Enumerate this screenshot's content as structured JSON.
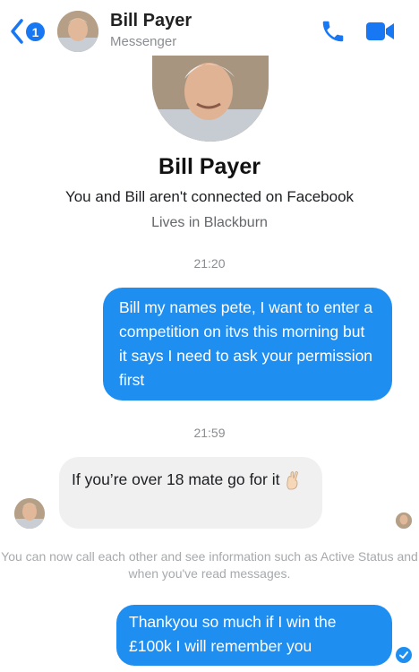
{
  "header": {
    "back_badge": "1",
    "contact_name": "Bill Payer",
    "app_label": "Messenger"
  },
  "profile": {
    "name": "Bill Payer",
    "connection_note": "You and Bill aren't connected on Facebook",
    "location": "Lives in Blackburn"
  },
  "messages": [
    {
      "type": "timestamp",
      "text": "21:20"
    },
    {
      "type": "outgoing",
      "text": "Bill my names pete, I want to enter a competition on itvs this morning but it says I need to ask your permission first"
    },
    {
      "type": "timestamp",
      "text": "21:59"
    },
    {
      "type": "incoming",
      "text": "If you’re over 18 mate go for it"
    },
    {
      "type": "system",
      "text": "You can now call each other and see information such as Active Status and when you've read messages."
    },
    {
      "type": "outgoing",
      "text": "Thankyou so much if I win the £100k I will remember you"
    }
  ],
  "colors": {
    "accent": "#1877f2",
    "outgoing_bubble": "#1f8ef1",
    "incoming_bubble": "#f0f0f0",
    "muted_text": "#8a8d91"
  },
  "icons": {
    "back": "chevron-left-icon",
    "call": "phone-icon",
    "video": "video-camera-icon",
    "emoji": "crossed-fingers-emoji",
    "delivered": "check-circle-icon"
  }
}
